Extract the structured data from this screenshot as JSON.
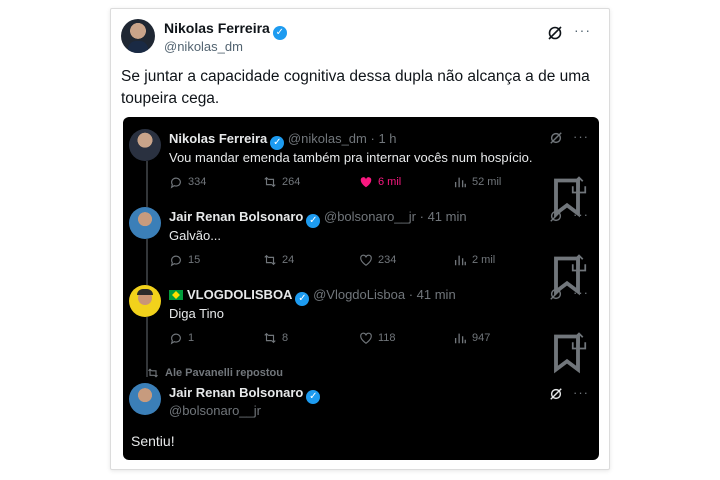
{
  "outer": {
    "name": "Nikolas Ferreira",
    "handle": "@nikolas_dm",
    "text": "Se juntar a capacidade cognitiva dessa dupla não alcança a de uma toupeira cega."
  },
  "embedded": {
    "posts": [
      {
        "name": "Nikolas Ferreira",
        "handle": "@nikolas_dm",
        "time": "1 h",
        "text": "Vou mandar emenda também pra internar vocês num hospício.",
        "replies": "334",
        "reposts": "264",
        "likes": "6 mil",
        "views": "52 mil"
      },
      {
        "name": "Jair Renan Bolsonaro",
        "handle": "@bolsonaro__jr",
        "time": "41 min",
        "text": "Galvão...",
        "replies": "15",
        "reposts": "24",
        "likes": "234",
        "views": "2 mil"
      },
      {
        "name": "VLOGDOLISBOA",
        "handle": "@VlogdoLisboa",
        "time": "41 min",
        "text": "Diga Tino",
        "replies": "1",
        "reposts": "8",
        "likes": "118",
        "views": "947"
      }
    ],
    "repost_label": "Ale Pavanelli repostou",
    "final": {
      "name": "Jair Renan Bolsonaro",
      "handle": "@bolsonaro__jr",
      "text": "Sentiu!"
    },
    "separator": "·"
  },
  "colors": {
    "verified": "#1d9bf0",
    "like_active": "#f91880",
    "dark_bg": "#000000"
  },
  "icons": [
    "verified-badge-icon",
    "grok-icon",
    "more-icon",
    "reply-icon",
    "repost-icon",
    "like-icon",
    "views-icon",
    "bookmark-icon",
    "share-icon",
    "brazil-flag-icon"
  ]
}
